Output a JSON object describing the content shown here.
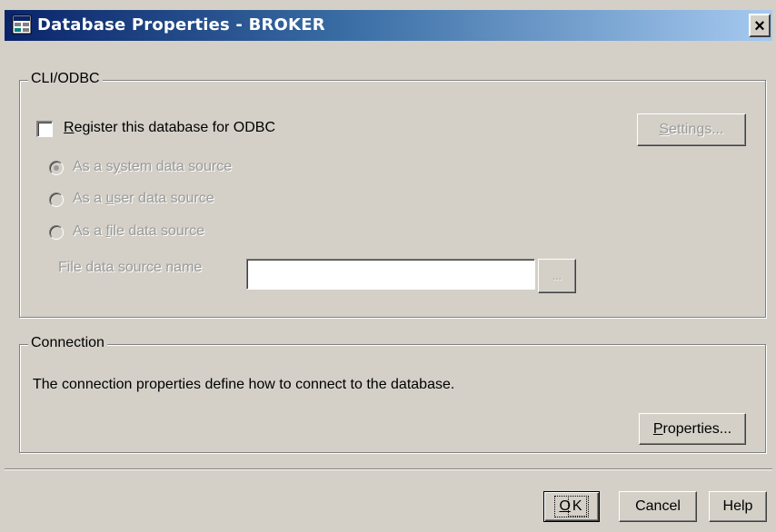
{
  "window": {
    "title": "Database Properties - BROKER",
    "close_label": "×",
    "icon": "database-app-icon"
  },
  "cli_odbc": {
    "legend": "CLI/ODBC",
    "register_checkbox": {
      "label_prefix": "",
      "mnemonic": "R",
      "label_rest": "egister this database for ODBC",
      "checked": false
    },
    "settings_button": {
      "mnemonic": "S",
      "label_rest": "ettings...",
      "enabled": false
    },
    "radios": [
      {
        "pre": "As a s",
        "mnemonic": "y",
        "post": "stem data source",
        "checked": true,
        "enabled": false
      },
      {
        "pre": "As a ",
        "mnemonic": "u",
        "post": "ser data source",
        "checked": false,
        "enabled": false
      },
      {
        "pre": "As a ",
        "mnemonic": "f",
        "post": "ile data source",
        "checked": false,
        "enabled": false
      }
    ],
    "file_ds_label": "File data source name",
    "file_ds_value": "",
    "browse_label": "..."
  },
  "connection": {
    "legend": "Connection",
    "description": "The connection properties define how to connect to the database.",
    "properties_button": {
      "mnemonic": "P",
      "label_rest": "roperties..."
    }
  },
  "footer": {
    "ok": {
      "mnemonic": "O",
      "label_rest": "K"
    },
    "cancel_label": "Cancel",
    "help_label": "Help"
  },
  "colors": {
    "dialog_bg": "#d4d0c8",
    "title_gradient_start": "#0a246a",
    "title_gradient_end": "#a6caf0",
    "disabled_text": "#9a9a9a"
  }
}
